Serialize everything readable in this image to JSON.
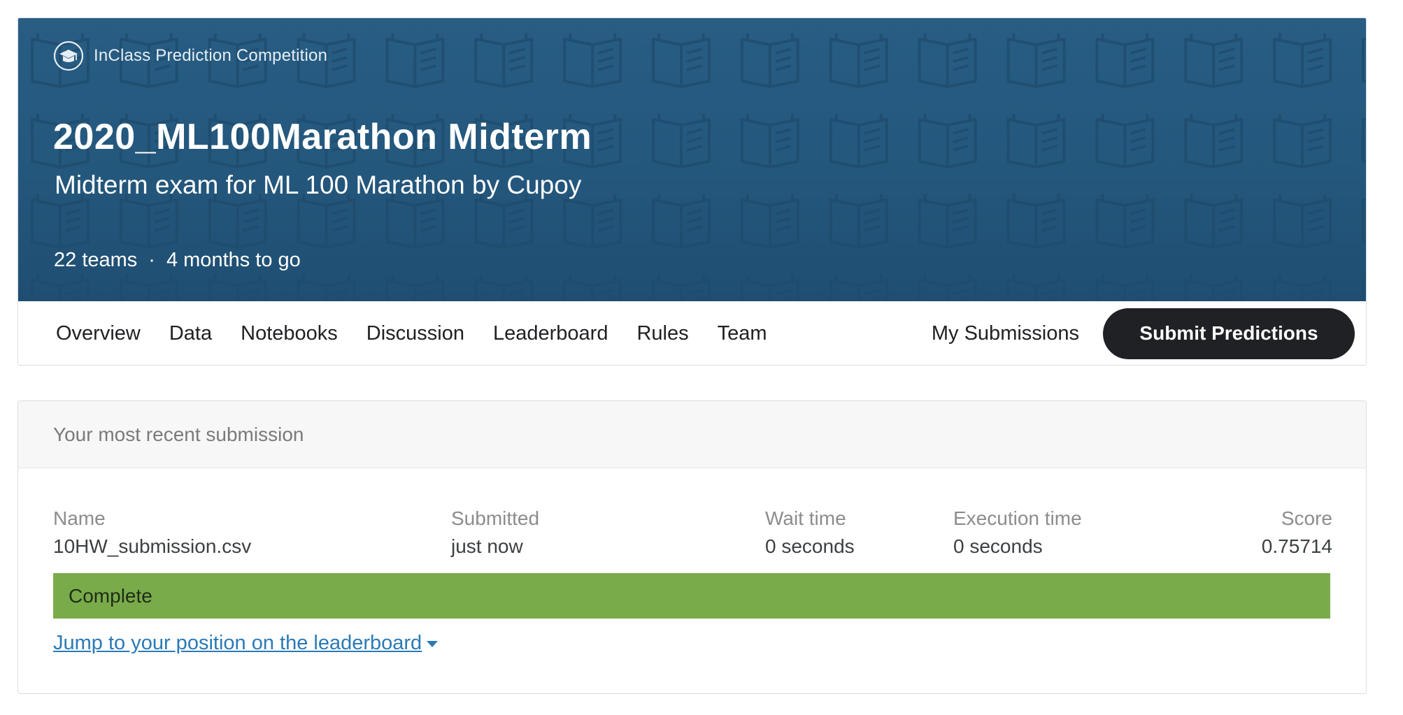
{
  "competition": {
    "badge_label": "InClass Prediction Competition",
    "badge_icon": "graduation-cap-icon",
    "title": "2020_ML100Marathon Midterm",
    "subtitle": "Midterm exam for ML 100 Marathon by Cupoy",
    "teams": "22 teams",
    "separator": "·",
    "time_left": "4 months to go",
    "banner_color": "#285d84",
    "banner_pattern_icon": "open-book-icon"
  },
  "nav": {
    "tabs": [
      {
        "label": "Overview"
      },
      {
        "label": "Data"
      },
      {
        "label": "Notebooks"
      },
      {
        "label": "Discussion"
      },
      {
        "label": "Leaderboard"
      },
      {
        "label": "Rules"
      },
      {
        "label": "Team"
      }
    ],
    "my_submissions": "My Submissions",
    "submit_button": "Submit Predictions"
  },
  "submission": {
    "header": "Your most recent submission",
    "columns": {
      "name": {
        "label": "Name",
        "value": "10HW_submission.csv"
      },
      "submitted": {
        "label": "Submitted",
        "value": "just now"
      },
      "wait": {
        "label": "Wait time",
        "value": "0 seconds"
      },
      "exec": {
        "label": "Execution time",
        "value": "0 seconds"
      },
      "score": {
        "label": "Score",
        "value": "0.75714"
      }
    },
    "status": "Complete",
    "status_color": "#7aab4b",
    "jump_link": "Jump to your position on the leaderboard",
    "jump_icon": "caret-down-icon",
    "link_color": "#2a7ab6"
  }
}
